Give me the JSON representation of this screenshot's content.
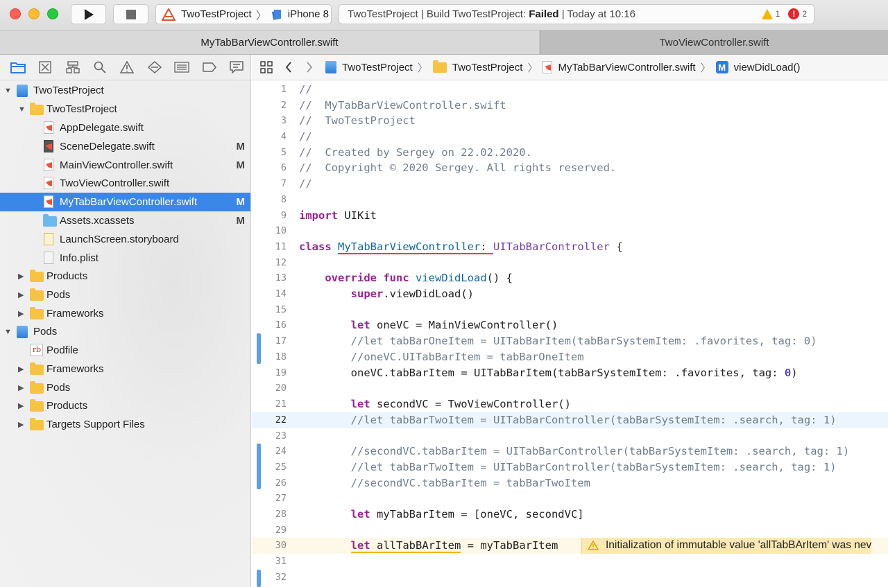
{
  "toolbar": {
    "scheme": "TwoTestProject",
    "device": "iPhone 8",
    "activity_prefix": "TwoTestProject | Build TwoTestProject: ",
    "activity_status": "Failed",
    "activity_suffix": " | Today at 10:16",
    "warning_count": "1",
    "error_count": "2"
  },
  "tabs": [
    {
      "label": "MyTabBarViewController.swift"
    },
    {
      "label": "TwoViewController.swift"
    }
  ],
  "navigator": {
    "icons": [
      "project-navigator-icon",
      "source-control-icon",
      "symbol-navigator-icon",
      "find-icon",
      "issue-navigator-icon",
      "test-navigator-icon",
      "debug-navigator-icon",
      "breakpoint-navigator-icon",
      "report-navigator-icon"
    ],
    "items": [
      {
        "label": "TwoTestProject",
        "flag": ""
      },
      {
        "label": "TwoTestProject",
        "flag": ""
      },
      {
        "label": "AppDelegate.swift",
        "flag": ""
      },
      {
        "label": "SceneDelegate.swift",
        "flag": "M"
      },
      {
        "label": "MainViewController.swift",
        "flag": "M"
      },
      {
        "label": "TwoViewController.swift",
        "flag": ""
      },
      {
        "label": "MyTabBarViewController.swift",
        "flag": "M"
      },
      {
        "label": "Assets.xcassets",
        "flag": "M"
      },
      {
        "label": "LaunchScreen.storyboard",
        "flag": ""
      },
      {
        "label": "Info.plist",
        "flag": ""
      },
      {
        "label": "Products",
        "flag": ""
      },
      {
        "label": "Pods",
        "flag": ""
      },
      {
        "label": "Frameworks",
        "flag": ""
      },
      {
        "label": "Pods",
        "flag": ""
      },
      {
        "label": "Podfile",
        "flag": ""
      },
      {
        "label": "Frameworks",
        "flag": ""
      },
      {
        "label": "Pods",
        "flag": ""
      },
      {
        "label": "Products",
        "flag": ""
      },
      {
        "label": "Targets Support Files",
        "flag": ""
      }
    ]
  },
  "jumpbar": {
    "project": "TwoTestProject",
    "group": "TwoTestProject",
    "file": "MyTabBarViewController.swift",
    "symbol_badge": "M",
    "symbol": "viewDidLoad()"
  },
  "editor": {
    "line_numbers": [
      "1",
      "2",
      "3",
      "4",
      "5",
      "6",
      "7",
      "8",
      "9",
      "10",
      "11",
      "12",
      "13",
      "14",
      "15",
      "16",
      "17",
      "18",
      "19",
      "20",
      "21",
      "22",
      "23",
      "24",
      "25",
      "26",
      "27",
      "28",
      "29",
      "30",
      "31",
      "32"
    ],
    "code": {
      "l1": "//",
      "l2": "//  MyTabBarViewController.swift",
      "l3": "//  TwoTestProject",
      "l4": "//",
      "l5": "//  Created by Sergey on 22.02.2020.",
      "l6": "//  Copyright © 2020 Sergey. All rights reserved.",
      "l7": "//",
      "l9_kw": "import",
      "l9_rest": " UIKit",
      "l11_kw": "class",
      "l11_name": "MyTabBarViewController",
      "l11_colon": ": ",
      "l11_super": "UITabBarController",
      "l11_brace": " {",
      "l13_kw1": "override",
      "l13_kw2": "func",
      "l13_name": "viewDidLoad",
      "l13_rest": "() {",
      "l14_kw": "super",
      "l14_rest": ".viewDidLoad()",
      "l16_kw": "let",
      "l16_var": " oneVC = ",
      "l16_type": "MainViewController",
      "l16_rest": "()",
      "l17": "//let tabBarOneItem = UITabBarItem(tabBarSystemItem: .favorites, tag: 0)",
      "l18": "//oneVC.UITabBarItem = tabBarOneItem",
      "l19_a": "oneVC.",
      "l19_b": "tabBarItem",
      "l19_c": " = ",
      "l19_d": "UITabBarItem",
      "l19_e": "(tabBarSystemItem: .",
      "l19_f": "favorites",
      "l19_g": ", tag: ",
      "l19_h": "0",
      "l19_i": ")",
      "l21_kw": "let",
      "l21_var": " secondVC = ",
      "l21_type": "TwoViewController",
      "l21_rest": "()",
      "l22": "//let tabBarTwoItem = UITabBarController(tabBarSystemItem: .search, tag: 1)",
      "l24": "//secondVC.tabBarItem = UITabBarController(tabBarSystemItem: .search, tag: 1)",
      "l25": "//let tabBarTwoItem = UITabBarController(tabBarSystemItem: .search, tag: 1)",
      "l26": "//secondVC.tabBarItem = tabBarTwoItem",
      "l28_kw": "let",
      "l28_rest": " myTabBarItem = [oneVC, secondVC]",
      "l30_kw": "let",
      "l30_sp": " ",
      "l30_var": "allTabBArItem",
      "l30_rest": " = myTabBarItem"
    },
    "warning_message": "Initialization of immutable value 'allTabBArItem' was nev"
  },
  "colors": {
    "selection": "#3b87e8",
    "keyword": "#9b2393",
    "comment": "#707f8c",
    "type": "#3900a0",
    "warning": "#f7b500",
    "error": "#e0282e"
  }
}
